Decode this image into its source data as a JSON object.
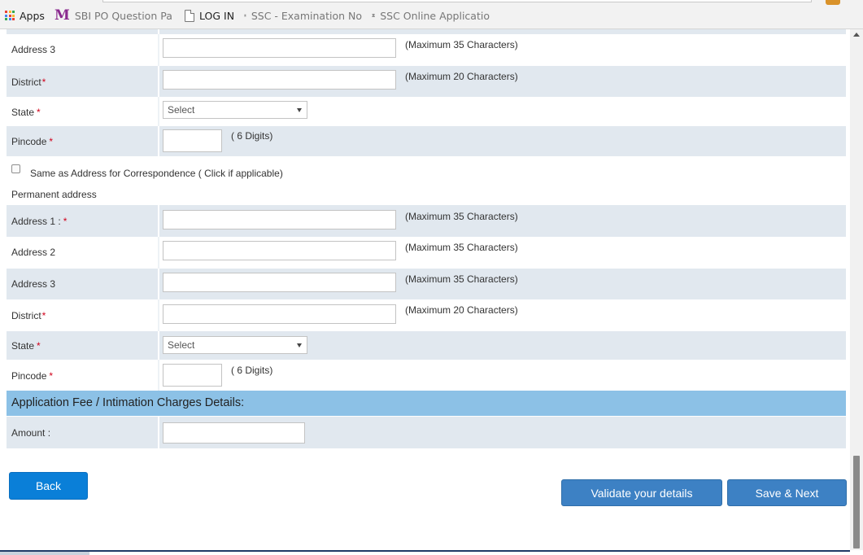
{
  "bookmarks": [
    {
      "label": "Apps",
      "icon": "apps-grid-icon"
    },
    {
      "label": "SBI PO Question Pape",
      "icon": "m-logo-icon"
    },
    {
      "label": "LOG IN",
      "icon": "document-icon"
    },
    {
      "label": "SSC - Examination No",
      "icon": "emblem-icon"
    },
    {
      "label": "SSC Online Applicatio",
      "icon": "emblem-icon"
    }
  ],
  "correspondence": {
    "address3": {
      "label": "Address 3",
      "hint": "(Maximum 35 Characters)",
      "value": ""
    },
    "district": {
      "label": "District",
      "hint": "(Maximum 20 Characters)",
      "value": ""
    },
    "state": {
      "label": "State",
      "selected": "Select"
    },
    "pincode": {
      "label": "Pincode",
      "hint": "( 6 Digits)",
      "value": ""
    }
  },
  "same_as_checkbox": {
    "label": "Same as Address for Correspondence ( Click if applicable)",
    "checked": false
  },
  "permanent": {
    "heading": "Permanent address",
    "address1": {
      "label": "Address 1 :",
      "hint": "(Maximum 35 Characters)",
      "value": ""
    },
    "address2": {
      "label": "Address 2",
      "hint": "(Maximum 35 Characters)",
      "value": ""
    },
    "address3": {
      "label": "Address 3",
      "hint": "(Maximum 35 Characters)",
      "value": ""
    },
    "district": {
      "label": "District",
      "hint": "(Maximum 20 Characters)",
      "value": ""
    },
    "state": {
      "label": "State",
      "selected": "Select"
    },
    "pincode": {
      "label": "Pincode",
      "hint": "( 6 Digits)",
      "value": ""
    }
  },
  "fee": {
    "heading": "Application Fee / Intimation Charges Details:",
    "amount_label": "Amount :",
    "amount_value": ""
  },
  "required_marker": "*",
  "buttons": {
    "back": "Back",
    "validate": "Validate your details",
    "save_next": "Save & Next"
  },
  "colors": {
    "row_alt": "#e1e8ef",
    "fee_header": "#8cc1e6",
    "back_button": "#0a7fd8",
    "primary_button": "#3d81c4",
    "required": "#d0021b"
  }
}
